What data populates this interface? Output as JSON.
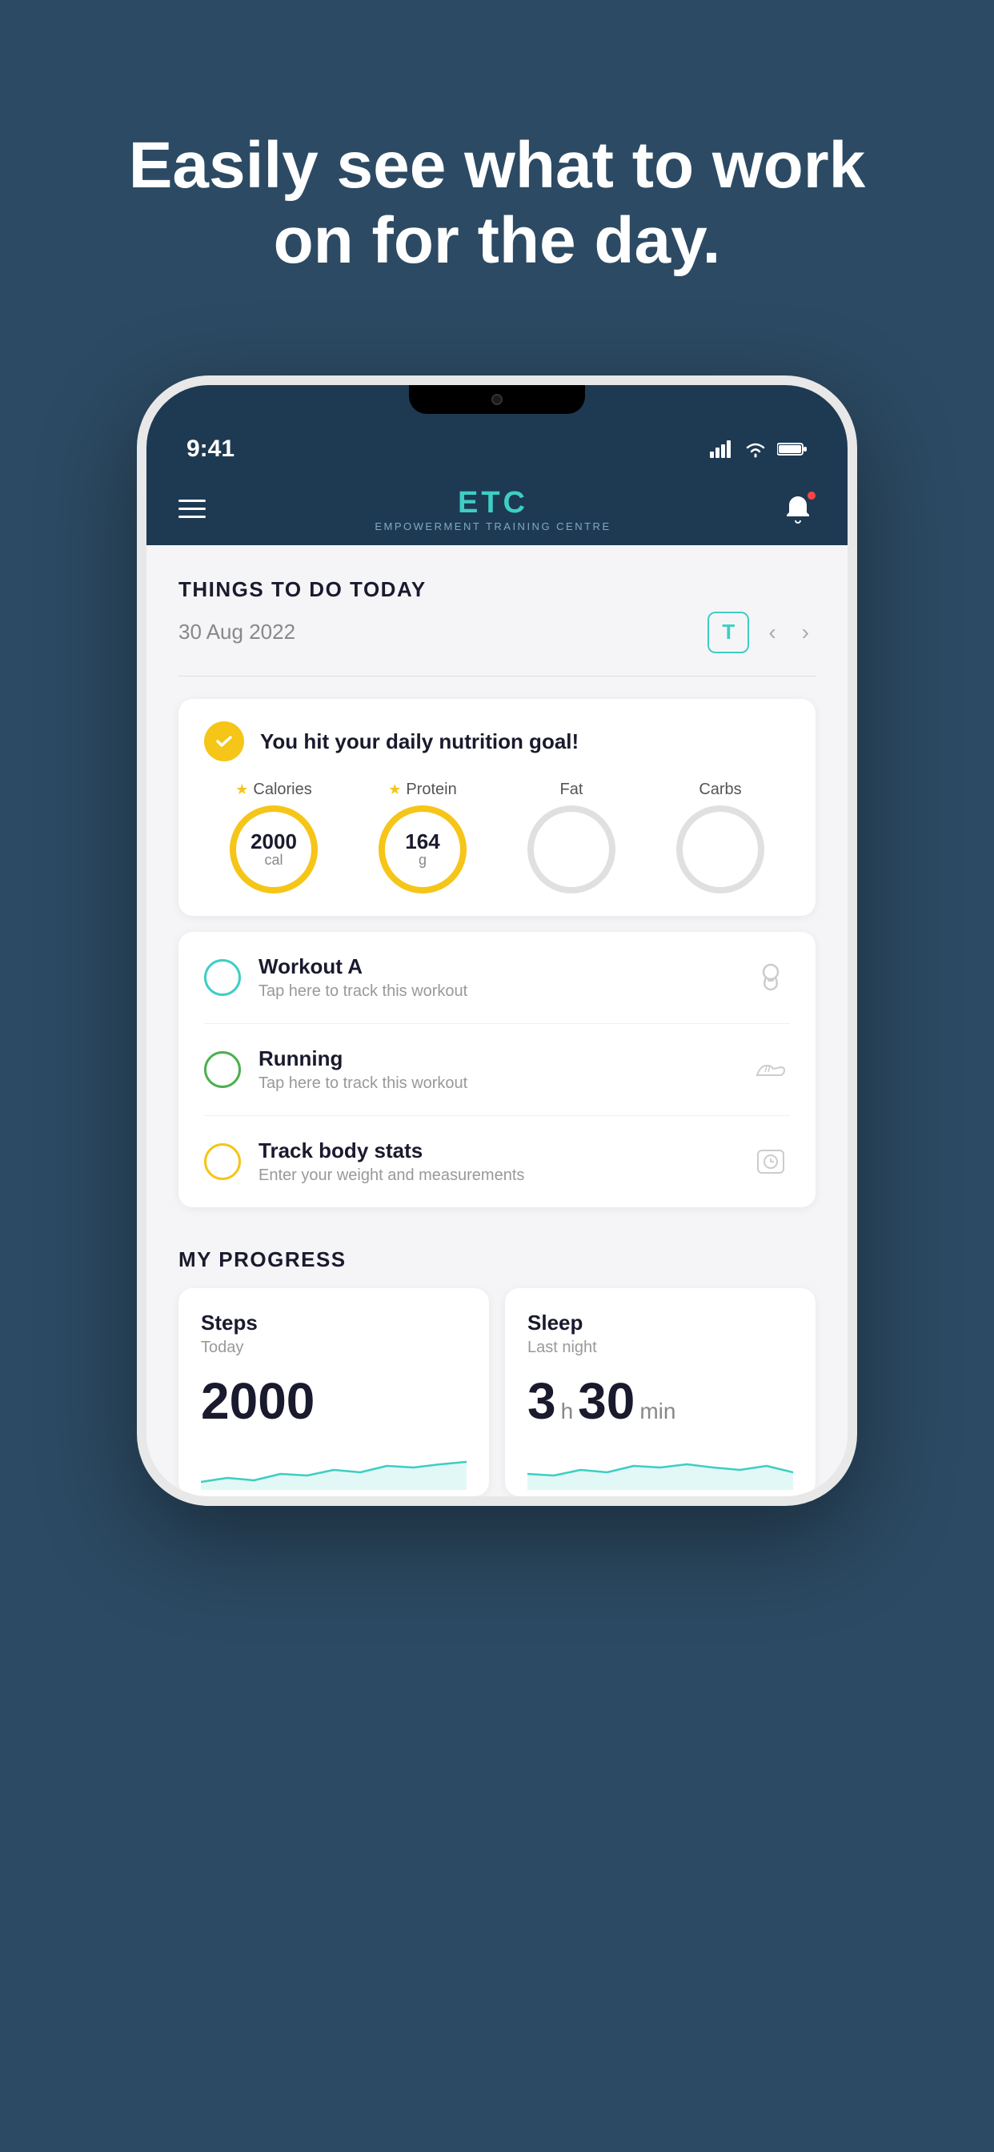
{
  "hero": {
    "tagline": "Easily see what to work on for the day."
  },
  "status_bar": {
    "time": "9:41",
    "signal": "▌▌▌▌",
    "wifi": "wifi",
    "battery": "battery"
  },
  "app_header": {
    "logo_title": "ETC",
    "logo_subtitle": "EMPOWERMENT TRAINING CENTRE",
    "hamburger_label": "menu"
  },
  "page_section": {
    "title": "THINGS TO DO TODAY",
    "date": "30 Aug 2022",
    "today_btn_label": "T"
  },
  "nutrition": {
    "goal_text": "You hit your daily nutrition goal!",
    "macros": [
      {
        "label": "Calories",
        "value": "2000",
        "unit": "cal",
        "filled": true
      },
      {
        "label": "Protein",
        "value": "164",
        "unit": "g",
        "filled": true
      },
      {
        "label": "Fat",
        "value": "",
        "unit": "",
        "filled": false
      },
      {
        "label": "Carbs",
        "value": "",
        "unit": "",
        "filled": false
      }
    ]
  },
  "tasks": [
    {
      "name": "Workout A",
      "sub": "Tap here to track this workout",
      "circle_color": "blue",
      "icon": "kettlebell"
    },
    {
      "name": "Running",
      "sub": "Tap here to track this workout",
      "circle_color": "green",
      "icon": "shoe"
    },
    {
      "name": "Track body stats",
      "sub": "Enter your weight and measurements",
      "circle_color": "yellow",
      "icon": "scale"
    }
  ],
  "progress": {
    "section_title": "MY PROGRESS",
    "cards": [
      {
        "title": "Steps",
        "subtitle": "Today",
        "value_main": "2000",
        "value_h": "",
        "value_min": ""
      },
      {
        "title": "Sleep",
        "subtitle": "Last night",
        "value_main": "",
        "value_h": "3",
        "value_min": "30"
      }
    ]
  }
}
